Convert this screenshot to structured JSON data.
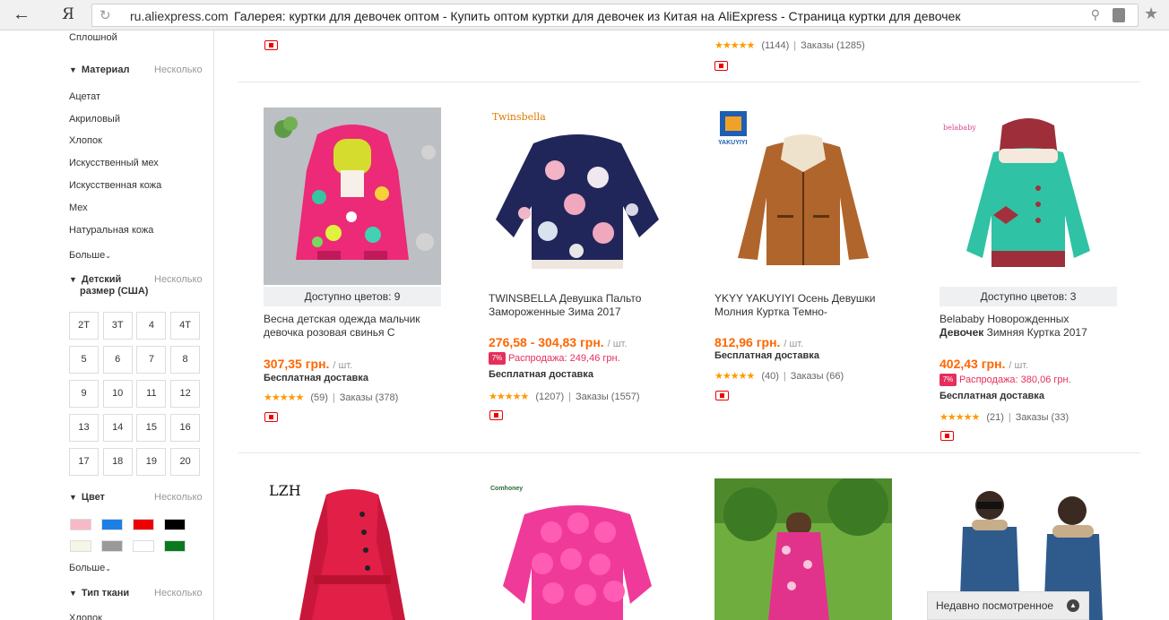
{
  "browser": {
    "back_glyph": "←",
    "logo": "Я",
    "domain": "ru.aliexpress.com",
    "title": "Галерея: куртки для девочек оптом - Купить оптом куртки для девочек из Китая на AliExpress - Страница куртки для девочек",
    "reload_icon": "reload-icon",
    "search_icon": "search-icon",
    "lock_icon": "lock-icon",
    "bookmark_icon": "star-icon"
  },
  "sidebar": {
    "top_item": "Сплошной",
    "material": {
      "heading": "Материал",
      "multi": "Несколько",
      "items": [
        "Ацетат",
        "Акриловый",
        "Хлопок",
        "Искусственный мех",
        "Искусственная кожа",
        "Мех",
        "Натуральная кожа"
      ],
      "more": "Больше"
    },
    "size": {
      "heading_line1": "Детский",
      "heading_line2": "размер (США)",
      "multi": "Несколько",
      "items": [
        "2T",
        "3T",
        "4",
        "4T",
        "5",
        "6",
        "7",
        "8",
        "9",
        "10",
        "11",
        "12",
        "13",
        "14",
        "15",
        "16",
        "17",
        "18",
        "19",
        "20"
      ]
    },
    "color": {
      "heading": "Цвет",
      "multi": "Несколько",
      "swatches": [
        "#f7b8c8",
        "#1b7fe6",
        "#ee0000",
        "#000000",
        "#f6f6e6",
        "#999999",
        "#ffffff",
        "#0a7a1f"
      ],
      "more": "Больше"
    },
    "fabric": {
      "heading": "Тип ткани",
      "multi": "Несколько",
      "first_item": "Хлопок"
    }
  },
  "top_partial": {
    "rating_count": "(1144)",
    "orders": "Заказы (1285)"
  },
  "products": [
    {
      "colors": "Доступно цветов: 9",
      "title": "Весна детская одежда мальчик девочка розовая свинья С",
      "price": "307,35 грн.",
      "unit": "/ шт.",
      "shipping": "Бесплатная доставка",
      "rating_count": "(59)",
      "orders": "Заказы (378)"
    },
    {
      "title": "TWINSBELLA Девушка Пальто Замороженные Зима 2017",
      "price": "276,58 - 304,83 грн.",
      "unit": "/ шт.",
      "sale": "Распродажа: 249,46 грн.",
      "shipping": "Бесплатная доставка",
      "rating_count": "(1207)",
      "orders": "Заказы (1557)",
      "brand": "Twinsbella"
    },
    {
      "title": "YKYY YAKUYIYI Осень Девушки Молния Куртка Темно-",
      "price": "812,96 грн.",
      "unit": "/ шт.",
      "shipping": "Бесплатная доставка",
      "rating_count": "(40)",
      "orders": "Заказы (66)",
      "brand": "YAKUYIYI"
    },
    {
      "colors": "Доступно цветов: 3",
      "title_part1": "Belababy Новорожденных",
      "title_bold": "Девочек",
      "title_part2": "Зимняя Куртка 2017",
      "price": "402,43 грн.",
      "unit": "/ шт.",
      "sale": "Распродажа: 380,06 грн.",
      "shipping": "Бесплатная доставка",
      "rating_count": "(21)",
      "orders": "Заказы (33)",
      "brand": "belababy"
    }
  ],
  "row2_brands": {
    "lzh": "LZH",
    "comhoney": "Comhoney"
  },
  "sale_badge": "7%",
  "stars": "★★★★★",
  "rate_sep": "|",
  "recent": {
    "label": "Недавно посмотренное",
    "icon": "chevron-up-icon"
  }
}
